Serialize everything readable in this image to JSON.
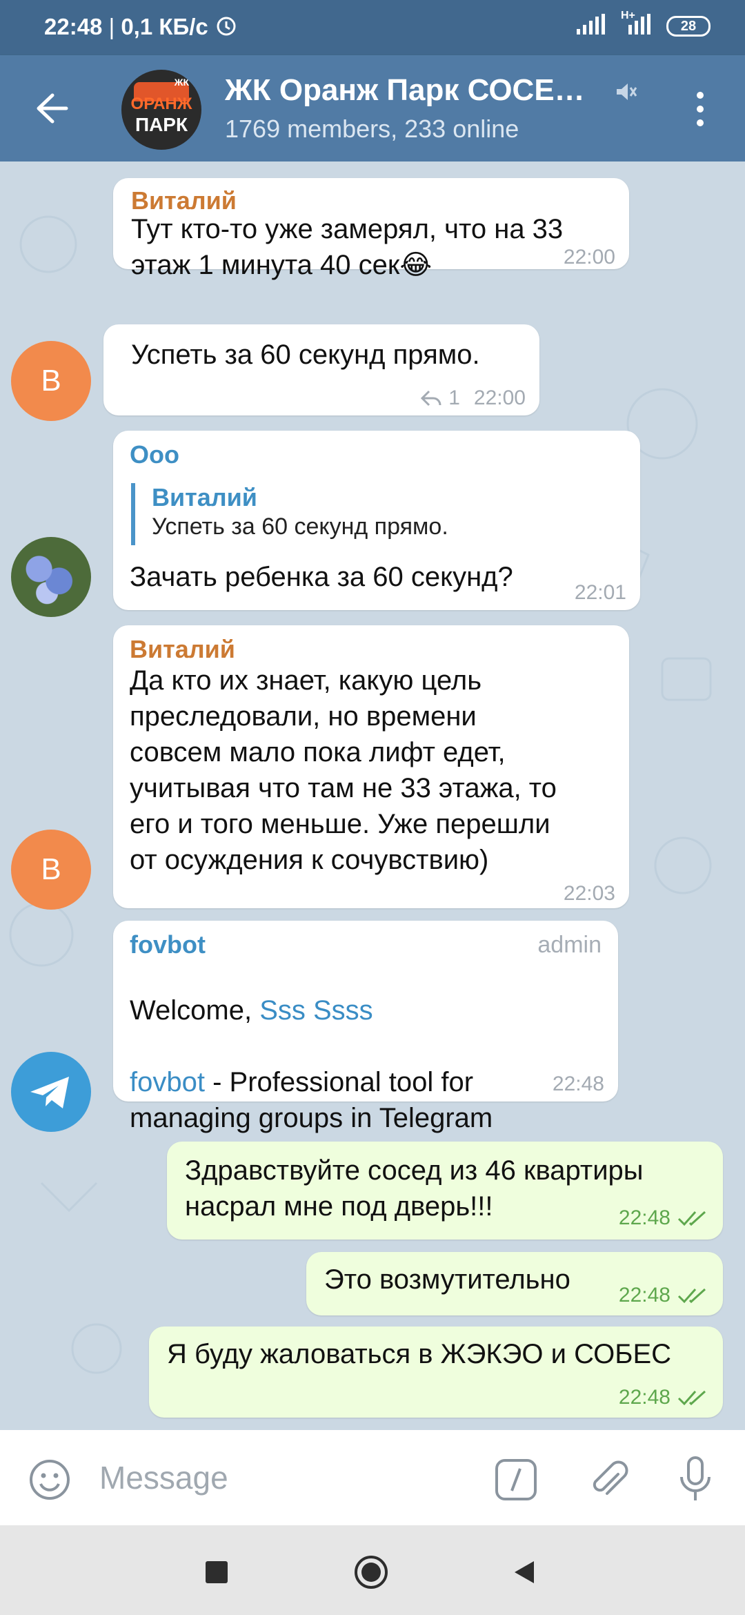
{
  "status_bar": {
    "time": "22:48",
    "speed": "0,1 КБ/с",
    "battery": "28",
    "network": "H+"
  },
  "header": {
    "avatar_top": "ОРАНЖ",
    "avatar_bottom": "ПАРК",
    "avatar_corner": "ЖК",
    "title": "ЖК Оранж Парк СОСЕ…",
    "subtitle": "1769 members, 233 online"
  },
  "messages": [
    {
      "sender": "Виталий",
      "text": "Тут кто-то уже замерял, что на 33\nэтаж 1 минута 40 сек😂",
      "time": "22:00"
    },
    {
      "avatar_letter": "В",
      "text": "Успеть за 60 секунд прямо.",
      "reply_count": "1",
      "time": "22:00"
    },
    {
      "sender": "Ооо",
      "reply_name": "Виталий",
      "reply_text": "Успеть за 60 секунд прямо.",
      "text": "Зачать ребенка за 60 секунд?",
      "time": "22:01"
    },
    {
      "sender": "Виталий",
      "avatar_letter": "В",
      "text": "Да кто их знает, какую цель\nпреследовали, но времени\nсовсем мало пока лифт едет,\nучитывая что там не 33 этажа, то\nего и того меньше. Уже перешли\nот осуждения к сочувствию)",
      "time": "22:03"
    },
    {
      "sender": "fovbot",
      "admin": "admin",
      "welcome": "Welcome, ",
      "welcome_name": "Sss Ssss",
      "bot_link": "fovbot",
      "bot_text": " - Professional tool for\nmanaging groups in Telegram",
      "time": "22:48"
    }
  ],
  "outgoing": [
    {
      "text": "Здравствуйте сосед из 46 квартиры\nнасрал мне под дверь!!!",
      "time": "22:48"
    },
    {
      "text": "Это возмутительно",
      "time": "22:48"
    },
    {
      "text": "Я буду жаловаться в ЖЭКЭО и СОБЕС",
      "time": "22:48"
    }
  ],
  "input": {
    "placeholder": "Message"
  },
  "colors": {
    "header": "#517ba5",
    "sender_orange": "#cc7a33",
    "sender_blue": "#3e8fc4",
    "outgoing_bubble": "#effedd",
    "check_green": "#5ea74d"
  }
}
